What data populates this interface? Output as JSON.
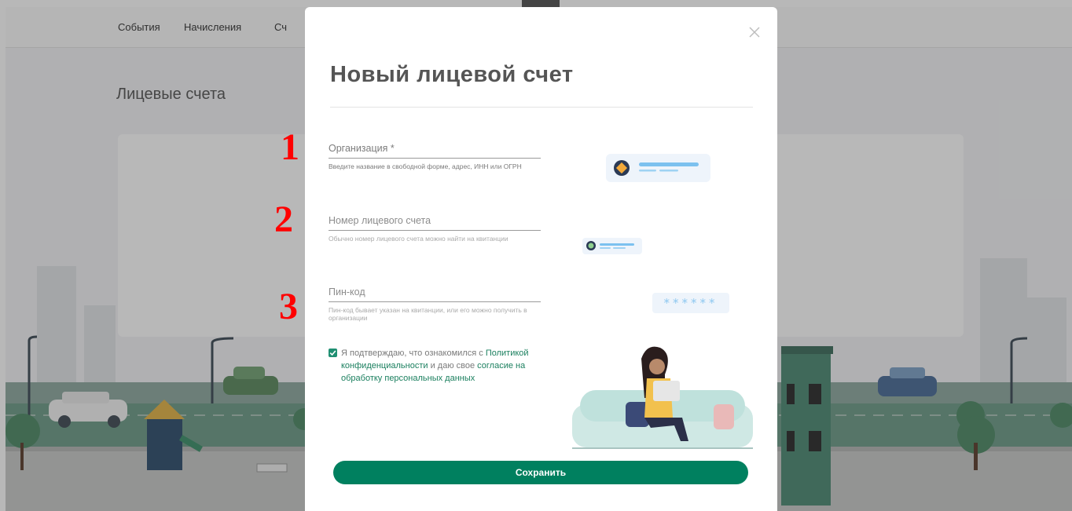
{
  "nav": {
    "events": "События",
    "charges": "Начисления",
    "third": "Сч"
  },
  "page": {
    "title": "Лицевые счета"
  },
  "modal": {
    "title": "Новый лицевой счет",
    "fields": [
      {
        "label": "Организация *",
        "hint": "Введите название в свободной форме, адрес, ИНН или ОГРН"
      },
      {
        "label": "Номер лицевого счета",
        "hint": "Обычно номер лицевого счета можно найти на квитанции"
      },
      {
        "label": "Пин-код",
        "hint": "Пин-код бывает указан на квитанции, или его можно получить в организации"
      }
    ],
    "consent": {
      "before": "Я подтверждаю, что ознакомился с ",
      "policy_link": "Политикой конфиденциальности",
      "middle": " и даю свое ",
      "agreement_link": "согласие на обработку персональных данных"
    },
    "pin_mask": "******",
    "save_label": "Сохранить"
  },
  "annotations": [
    "1",
    "2",
    "3"
  ],
  "colors": {
    "accent": "#00805f",
    "link": "#1a7f5e",
    "annotation": "#ff0000"
  }
}
